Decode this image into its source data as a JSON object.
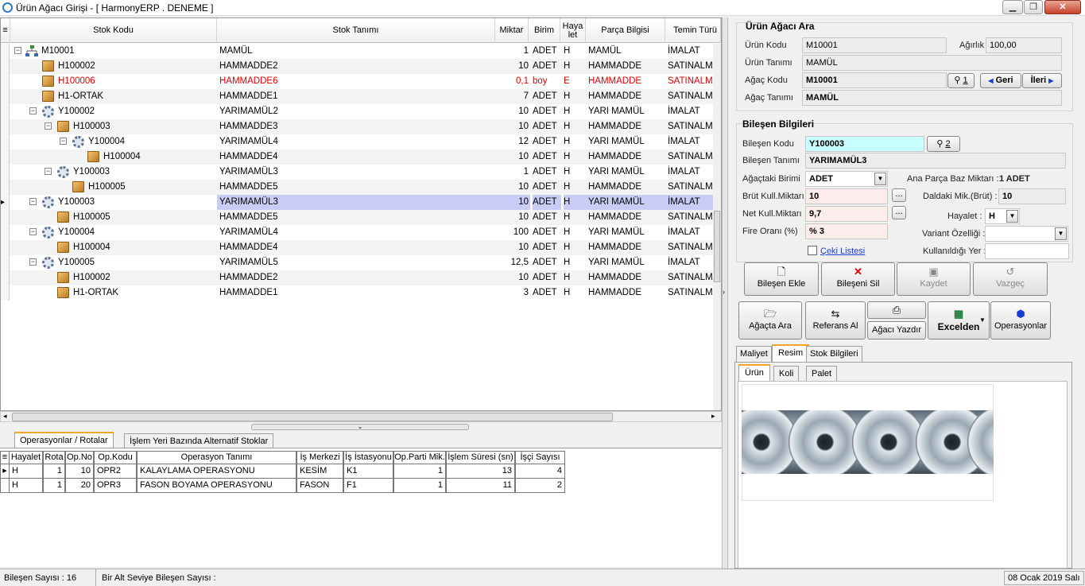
{
  "window": {
    "title": "Ürün Ağacı Girişi - [ HarmonyERP . DENEME ]",
    "min": "▁",
    "max": "❐",
    "close": "✕"
  },
  "grid": {
    "headers": [
      "Stok Kodu",
      "Stok Tanımı",
      "Miktar",
      "Birim",
      "Haya let",
      "Parça Bilgisi",
      "Temin Türü"
    ],
    "rows": [
      {
        "code": "M10001",
        "desc": "MAMÜL",
        "qty": "1",
        "unit": "ADET",
        "hay": "H",
        "part": "MAMÜL",
        "temin": "İMALAT",
        "icon": "net",
        "level": 0,
        "toggle": "⊟"
      },
      {
        "code": "H100002",
        "desc": "HAMMADDE2",
        "qty": "10",
        "unit": "ADET",
        "hay": "H",
        "part": "HAMMADDE",
        "temin": "SATINALMA",
        "icon": "box",
        "level": 1,
        "toggle": ""
      },
      {
        "code": "H100006",
        "desc": "HAMMADDE6",
        "qty": "0,1",
        "unit": "boy",
        "hay": "E",
        "part": "HAMMADDE",
        "temin": "SATINALMA",
        "icon": "box",
        "level": 1,
        "toggle": "",
        "red": true
      },
      {
        "code": "H1-ORTAK",
        "desc": "HAMMADDE1",
        "qty": "7",
        "unit": "ADET",
        "hay": "H",
        "part": "HAMMADDE",
        "temin": "SATINALMA",
        "icon": "box",
        "level": 1,
        "toggle": ""
      },
      {
        "code": "Y100002",
        "desc": "YARIMAMÜL2",
        "qty": "10",
        "unit": "ADET",
        "hay": "H",
        "part": "YARI MAMÜL",
        "temin": "İMALAT",
        "icon": "gear",
        "level": 1,
        "toggle": "⊟"
      },
      {
        "code": "H100003",
        "desc": "HAMMADDE3",
        "qty": "10",
        "unit": "ADET",
        "hay": "H",
        "part": "HAMMADDE",
        "temin": "SATINALMA",
        "icon": "box",
        "level": 2,
        "toggle": "⊟"
      },
      {
        "code": "Y100004",
        "desc": "YARIMAMÜL4",
        "qty": "12",
        "unit": "ADET",
        "hay": "H",
        "part": "YARI MAMÜL",
        "temin": "İMALAT",
        "icon": "gear",
        "level": 3,
        "toggle": "⊟"
      },
      {
        "code": "H100004",
        "desc": "HAMMADDE4",
        "qty": "10",
        "unit": "ADET",
        "hay": "H",
        "part": "HAMMADDE",
        "temin": "SATINALMA",
        "icon": "box",
        "level": 4,
        "toggle": ""
      },
      {
        "code": "Y100003",
        "desc": "YARIMAMÜL3",
        "qty": "1",
        "unit": "ADET",
        "hay": "H",
        "part": "YARI MAMÜL",
        "temin": "İMALAT",
        "icon": "gear",
        "level": 2,
        "toggle": "⊟"
      },
      {
        "code": "H100005",
        "desc": "HAMMADDE5",
        "qty": "10",
        "unit": "ADET",
        "hay": "H",
        "part": "HAMMADDE",
        "temin": "SATINALMA",
        "icon": "box",
        "level": 3,
        "toggle": ""
      },
      {
        "code": "Y100003",
        "desc": "YARIMAMÜL3",
        "qty": "10",
        "unit": "ADET",
        "hay": "H",
        "part": "YARI MAMÜL",
        "temin": "İMALAT",
        "icon": "gear",
        "level": 1,
        "toggle": "⊟",
        "selected": true
      },
      {
        "code": "H100005",
        "desc": "HAMMADDE5",
        "qty": "10",
        "unit": "ADET",
        "hay": "H",
        "part": "HAMMADDE",
        "temin": "SATINALMA",
        "icon": "box",
        "level": 2,
        "toggle": ""
      },
      {
        "code": "Y100004",
        "desc": "YARIMAMÜL4",
        "qty": "100",
        "unit": "ADET",
        "hay": "H",
        "part": "YARI MAMÜL",
        "temin": "İMALAT",
        "icon": "gear",
        "level": 1,
        "toggle": "⊟"
      },
      {
        "code": "H100004",
        "desc": "HAMMADDE4",
        "qty": "10",
        "unit": "ADET",
        "hay": "H",
        "part": "HAMMADDE",
        "temin": "SATINALMA",
        "icon": "box",
        "level": 2,
        "toggle": ""
      },
      {
        "code": "Y100005",
        "desc": "YARIMAMÜL5",
        "qty": "12,5",
        "unit": "ADET",
        "hay": "H",
        "part": "YARI MAMÜL",
        "temin": "İMALAT",
        "icon": "gear",
        "level": 1,
        "toggle": "⊟"
      },
      {
        "code": "H100002",
        "desc": "HAMMADDE2",
        "qty": "10",
        "unit": "ADET",
        "hay": "H",
        "part": "HAMMADDE",
        "temin": "SATINALMA",
        "icon": "box",
        "level": 2,
        "toggle": ""
      },
      {
        "code": "H1-ORTAK",
        "desc": "HAMMADDE1",
        "qty": "3",
        "unit": "ADET",
        "hay": "H",
        "part": "HAMMADDE",
        "temin": "SATINALMA",
        "icon": "box",
        "level": 2,
        "toggle": ""
      }
    ]
  },
  "bottom": {
    "tabs": [
      "Operasyonlar / Rotalar",
      "İşlem Yeri Bazında Alternatif Stoklar"
    ],
    "headers": [
      "Hayalet",
      "Rota",
      "Op.No",
      "Op.Kodu",
      "Operasyon Tanımı",
      "İş Merkezi",
      "İş İstasyonu",
      "Op.Parti Mik.",
      "İşlem Süresi (sn)",
      "İşçi Sayısı"
    ],
    "rows": [
      [
        "H",
        "1",
        "10",
        "OPR2",
        "KALAYLAMA OPERASYONU",
        "KESİM",
        "K1",
        "1",
        "13",
        "4"
      ],
      [
        "H",
        "1",
        "20",
        "OPR3",
        "FASON BOYAMA OPERASYONU",
        "FASON",
        "F1",
        "1",
        "11",
        "2"
      ]
    ]
  },
  "search": {
    "title": "Ürün Ağacı Ara",
    "urun_kodu_label": "Ürün Kodu",
    "urun_kodu": "M10001",
    "agirlik_label": "Ağırlık",
    "agirlik": "100,00",
    "urun_tanimi_label": "Ürün Tanımı",
    "urun_tanimi": "MAMÜL",
    "agac_kodu_label": "Ağaç Kodu",
    "agac_kodu": "M10001",
    "agac_tanimi_label": "Ağaç Tanımı",
    "agac_tanimi": "MAMÜL",
    "find1": "1",
    "geri": "Geri",
    "ileri": "İleri"
  },
  "component": {
    "title": "Bileşen Bilgileri",
    "kod_label": "Bileşen Kodu",
    "kod": "Y100003",
    "find2": "2",
    "tanim_label": "Bileşen Tanımı",
    "tanim": "YARIMAMÜL3",
    "birim_label": "Ağaçtaki Birimi",
    "birim": "ADET",
    "ana_label": "Ana Parça Baz Miktarı :",
    "ana": "1 ADET",
    "brut_label": "Brüt Kull.Miktarı",
    "brut": "10",
    "daldaki_label": "Daldaki Mik.(Brüt) :",
    "daldaki": "10",
    "net_label": "Net Kull.Miktarı",
    "net": "9,7",
    "hayalet_label": "Hayalet :",
    "hayalet": "H",
    "fire_label": "Fire Oranı (%)",
    "fire": "% 3",
    "variant_label": "Variant Özelliği :",
    "variant": "",
    "ceki": "Çeki Listesi",
    "kullan_label": "Kullanıldığı Yer :",
    "kullan": "",
    "dots": "..."
  },
  "buttons": {
    "ekle": "Bileşen Ekle",
    "sil": "Bileşeni Sil",
    "kaydet": "Kaydet",
    "vazgec": "Vazgeç",
    "agacta_ara": "Ağaçta Ara",
    "referans": "Referans Al",
    "yazdir": "Ağacı Yazdır",
    "excel": "Excelden",
    "operasyon": "Operasyonlar"
  },
  "rtabs": [
    "Maliyet",
    "Resim",
    "Stok Bilgileri"
  ],
  "subtabs": [
    "Ürün",
    "Koli",
    "Palet"
  ],
  "status": {
    "bilesen": "Bileşen Sayısı : 16",
    "altseviye": "Bir Alt Seviye Bileşen Sayısı :",
    "date": "08 Ocak 2019 Salı"
  }
}
